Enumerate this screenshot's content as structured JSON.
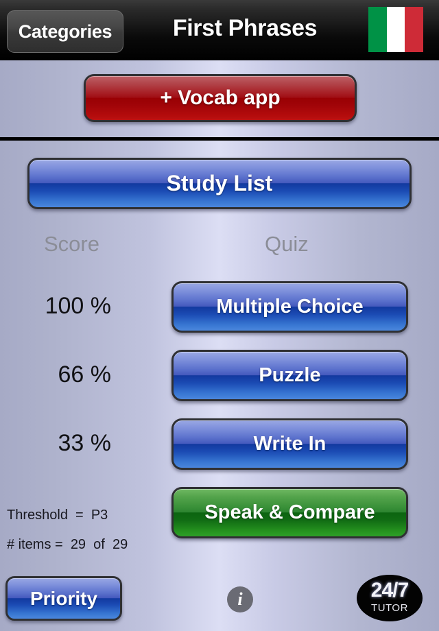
{
  "navbar": {
    "back_button_label": "Categories",
    "title": "First Phrases",
    "flag": {
      "name": "italian-flag",
      "colors": [
        "#009246",
        "#ffffff",
        "#ce2b37"
      ]
    }
  },
  "promo": {
    "vocab_app_label": "+ Vocab app",
    "color": "#a80c10"
  },
  "study": {
    "study_list_label": "Study List"
  },
  "columns": {
    "score_header": "Score",
    "quiz_header": "Quiz"
  },
  "scores": [
    {
      "value": "100 %"
    },
    {
      "value": "66 %"
    },
    {
      "value": "33 %"
    }
  ],
  "quiz_buttons": [
    {
      "label": "Multiple Choice",
      "color": "#2a4fb4",
      "style": "blue"
    },
    {
      "label": "Puzzle",
      "color": "#2a4fb4",
      "style": "blue"
    },
    {
      "label": "Write In",
      "color": "#2a4fb4",
      "style": "blue"
    },
    {
      "label": "Speak & Compare",
      "color": "#1d8a21",
      "style": "green"
    }
  ],
  "meta": {
    "threshold": "Threshold  =  P3",
    "items": "# items =  29  of  29"
  },
  "bottom_bar": {
    "priority_label": "Priority",
    "info_icon": "info-icon",
    "tutor_badge_top": "24/7",
    "tutor_badge_bottom": "TUTOR"
  }
}
